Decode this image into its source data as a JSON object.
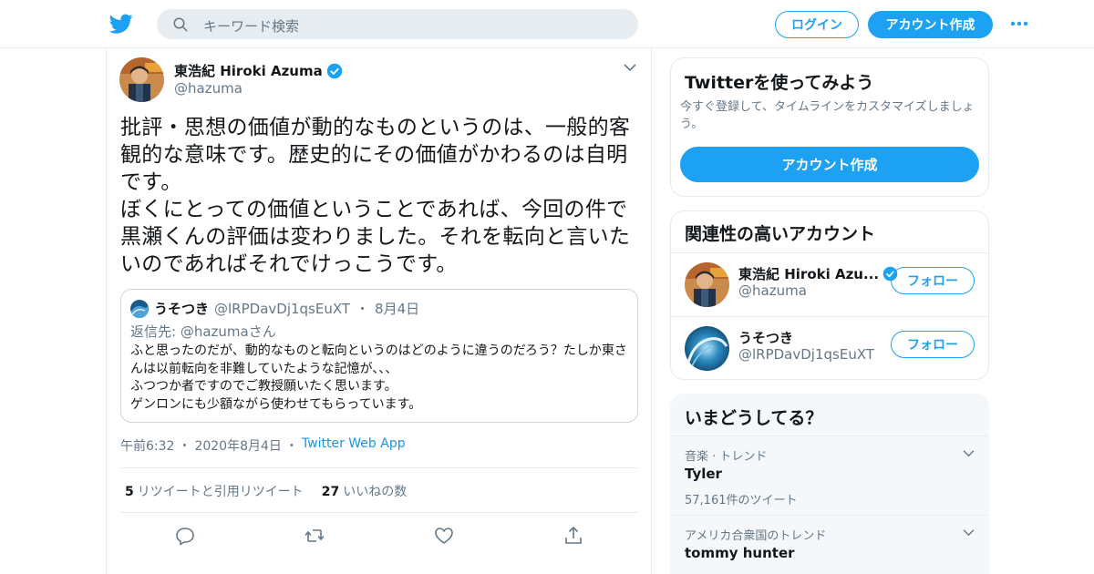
{
  "colors": {
    "accent": "#1da1f2",
    "text": "#14171a",
    "secondary": "#657786",
    "border": "#e6ecf0"
  },
  "header": {
    "logo_icon": "twitter-bird-icon",
    "search_placeholder": "キーワード検索",
    "login_label": "ログイン",
    "signup_label": "アカウント作成",
    "more_icon": "more-dots-icon"
  },
  "tweet": {
    "author_name": "東浩紀 Hiroki Azuma",
    "author_handle": "@hazuma",
    "text": "批評・思想の価値が動的なものというのは、一般的客観的な意味です。歴史的にその価値がかわるのは自明です。\nぼくにとっての価値ということであれば、今回の件で黒瀬くんの評価は変わりました。それを転向と言いたいのであればそれでけっこうです。",
    "quote": {
      "name": "うそつき",
      "handle": "@lRPDavDj1qsEuXT",
      "sep": "・",
      "date": "8月4日",
      "reply_to": "返信先: @hazumaさん",
      "body": "ふと思ったのだが、動的なものと転向というのはどのように違うのだろう？たしか東さんは以前転向を非難していたような記憶が、、、\nふつつか者ですのでご教授願いたく思います。\nゲンロンにも少額ながら使わせてもらっています。"
    },
    "time": "午前6:32",
    "sep": "・",
    "date": "2020年8月4日",
    "source": "Twitter Web App",
    "retweets": "5",
    "retweets_label": "リツイートと引用リツイート",
    "likes": "27",
    "likes_label": "いいねの数"
  },
  "sidebar": {
    "signup": {
      "title": "Twitterを使ってみよう",
      "desc": "今すぐ登録して、タイムラインをカスタマイズしましょう。",
      "button": "アカウント作成"
    },
    "related": {
      "title": "関連性の高いアカウント",
      "accounts": [
        {
          "name": "東浩紀 Hiroki Azu...",
          "handle": "@hazuma",
          "follow": "フォロー"
        },
        {
          "name": "うそつき",
          "handle": "@lRPDavDj1qsEuXT",
          "follow": "フォロー"
        }
      ]
    },
    "trends": {
      "title": "いまどうしてる？",
      "items": [
        {
          "category": "音楽 · トレンド",
          "name": "Tyler",
          "count": "57,161件のツイート"
        },
        {
          "category": "アメリカ合衆国のトレンド",
          "name": "tommy hunter",
          "count": ""
        }
      ]
    }
  }
}
